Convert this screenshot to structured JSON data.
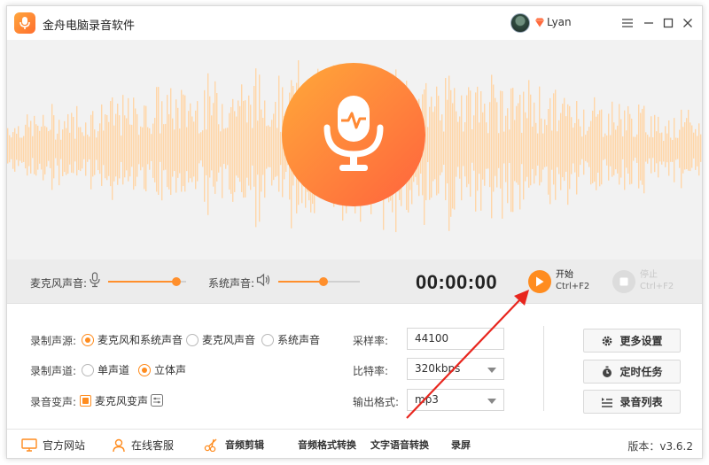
{
  "app": {
    "title": "金舟电脑录音软件"
  },
  "user": {
    "name": "Lyan"
  },
  "window_controls": {
    "menu": "☰",
    "minimize": "—",
    "maximize": "☐",
    "close": "✕"
  },
  "colors": {
    "accent": "#ff8c1f",
    "wave": "#ffd6a8",
    "mic_gradient_start": "#ffa23a",
    "mic_gradient_end": "#ff6a3d"
  },
  "controls": {
    "mic_volume_label": "麦克风声音:",
    "mic_volume": 0.88,
    "system_volume_label": "系统声音:",
    "system_volume": 0.55,
    "timer": "00:00:00",
    "start_label": "开始",
    "start_shortcut": "Ctrl+F2",
    "stop_label": "停止",
    "stop_shortcut": "Ctrl+F2"
  },
  "settings": {
    "source_label": "录制声源:",
    "source_options": [
      "麦克风和系统声音",
      "麦克风声音",
      "系统声音"
    ],
    "source_selected": 0,
    "channel_label": "录制声道:",
    "channel_options": [
      "单声道",
      "立体声"
    ],
    "channel_selected": 1,
    "voice_change_label": "录音变声:",
    "voice_change_option": "麦克风变声",
    "voice_change_checked": true,
    "sample_rate_label": "采样率:",
    "sample_rate_value": "44100",
    "bitrate_label": "比特率:",
    "bitrate_value": "320kbps",
    "format_label": "输出格式:",
    "format_value": "mp3"
  },
  "side_buttons": {
    "more_settings": "更多设置",
    "scheduled_task": "定时任务",
    "recording_list": "录音列表"
  },
  "bottom": {
    "website": "官方网站",
    "support": "在线客服",
    "audio_edit": "音频剪辑",
    "format_convert": "音频格式转换",
    "tts": "文字语音转换",
    "screen_record": "录屏",
    "version": "版本：v3.6.2"
  }
}
